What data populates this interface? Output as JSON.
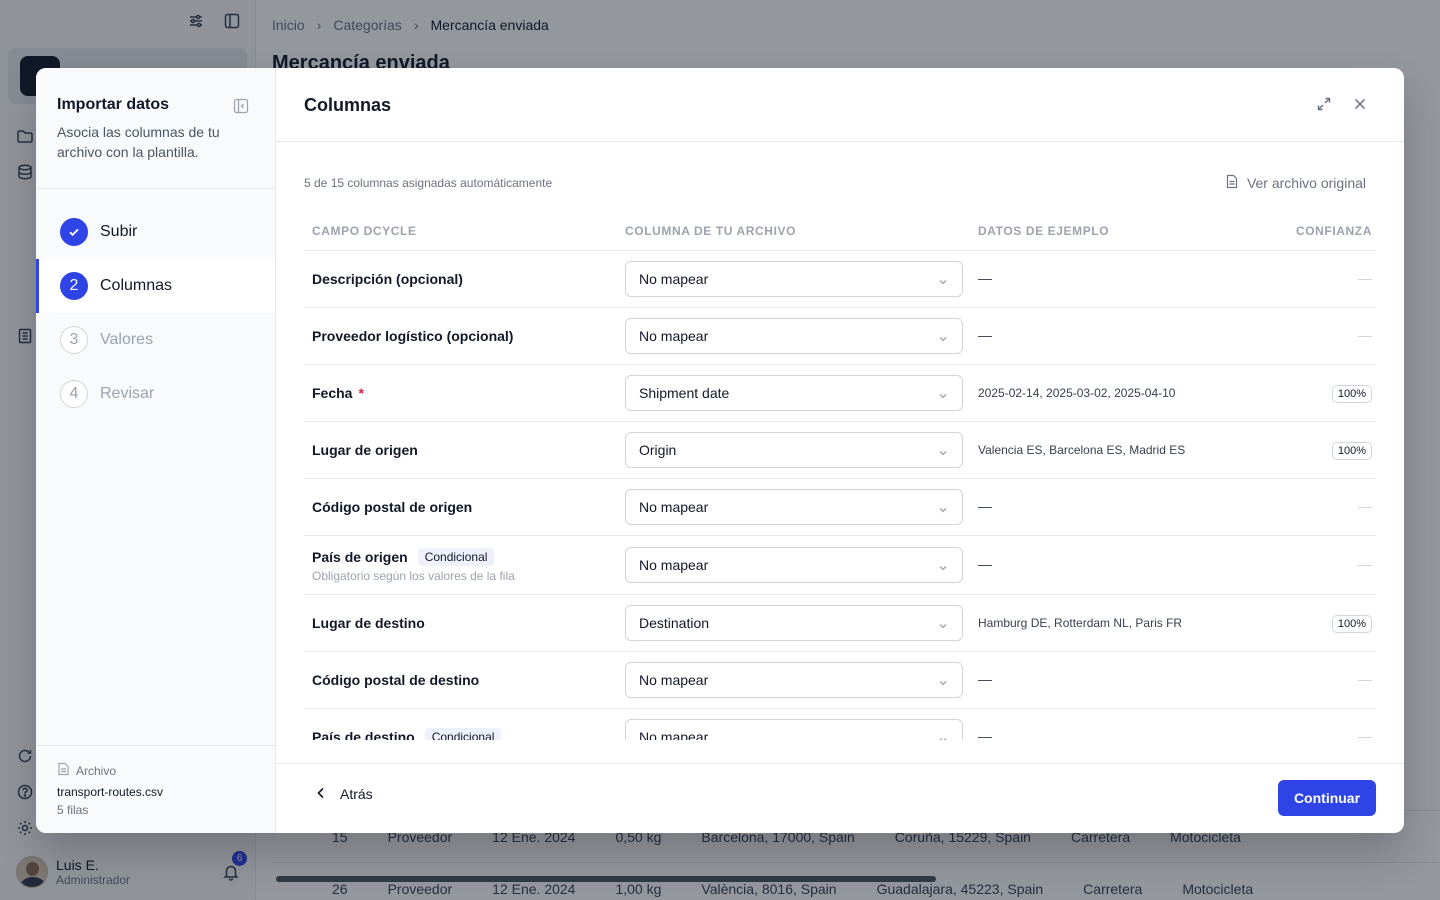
{
  "colors": {
    "accent": "#2e44e6",
    "required": "#e11d48",
    "overlay": "rgba(17,24,39,0.45)"
  },
  "background": {
    "breadcrumb": [
      "Inicio",
      "Categorías",
      "Mercancía enviada"
    ],
    "title": "Mercancía enviada",
    "user": {
      "name": "Luis E.",
      "role": "Administrador",
      "notifications": "6"
    },
    "rows": [
      [
        "15",
        "Proveedor",
        "12 Ene. 2024",
        "0,50 kg",
        "Barcelona, 17000, Spain",
        "Coruña, 15229, Spain",
        "Carretera",
        "Motocicleta"
      ],
      [
        "26",
        "Proveedor",
        "12 Ene. 2024",
        "1,00 kg",
        "València, 8016, Spain",
        "Guadalajara, 45223, Spain",
        "Carretera",
        "Motocicleta"
      ]
    ]
  },
  "sidebar": {
    "title": "Importar datos",
    "description": "Asocia las columnas de tu archivo con la plantilla.",
    "steps": [
      {
        "number": "✓",
        "label": "Subir",
        "state": "done"
      },
      {
        "number": "2",
        "label": "Columnas",
        "state": "active"
      },
      {
        "number": "3",
        "label": "Valores",
        "state": "pending"
      },
      {
        "number": "4",
        "label": "Revisar",
        "state": "pending"
      }
    ],
    "file": {
      "label": "Archivo",
      "name": "transport-routes.csv",
      "rows": "5 filas"
    }
  },
  "main": {
    "title": "Columnas",
    "summary": "5 de 15 columnas asignadas automáticamente",
    "view_original": "Ver archivo original",
    "headers": [
      "CAMPO DCYCLE",
      "COLUMNA DE TU ARCHIVO",
      "DATOS DE EJEMPLO",
      "CONFIANZA"
    ],
    "rows": [
      {
        "field": "Descripción (opcional)",
        "required": false,
        "badge": "",
        "sub": "",
        "column": "No mapear",
        "sample": "—",
        "confidence": "—"
      },
      {
        "field": "Proveedor logístico (opcional)",
        "required": false,
        "badge": "",
        "sub": "",
        "column": "No mapear",
        "sample": "—",
        "confidence": "—"
      },
      {
        "field": "Fecha",
        "required": true,
        "badge": "",
        "sub": "",
        "column": "Shipment date",
        "sample": "2025-02-14, 2025-03-02, 2025-04-10",
        "confidence": "100%"
      },
      {
        "field": "Lugar de origen",
        "required": false,
        "badge": "",
        "sub": "",
        "column": "Origin",
        "sample": "Valencia ES, Barcelona ES, Madrid ES",
        "confidence": "100%"
      },
      {
        "field": "Código postal de origen",
        "required": false,
        "badge": "",
        "sub": "",
        "column": "No mapear",
        "sample": "—",
        "confidence": "—"
      },
      {
        "field": "País de origen",
        "required": false,
        "badge": "Condicional",
        "sub": "Obligatorio según los valores de la fila",
        "column": "No mapear",
        "sample": "—",
        "confidence": "—"
      },
      {
        "field": "Lugar de destino",
        "required": false,
        "badge": "",
        "sub": "",
        "column": "Destination",
        "sample": "Hamburg DE, Rotterdam NL, Paris FR",
        "confidence": "100%"
      },
      {
        "field": "Código postal de destino",
        "required": false,
        "badge": "",
        "sub": "",
        "column": "No mapear",
        "sample": "—",
        "confidence": "—"
      },
      {
        "field": "País de destino",
        "required": false,
        "badge": "Condicional",
        "sub": "",
        "column": "No mapear",
        "sample": "—",
        "confidence": "—"
      }
    ],
    "back_label": "Atrás",
    "continue_label": "Continuar"
  }
}
